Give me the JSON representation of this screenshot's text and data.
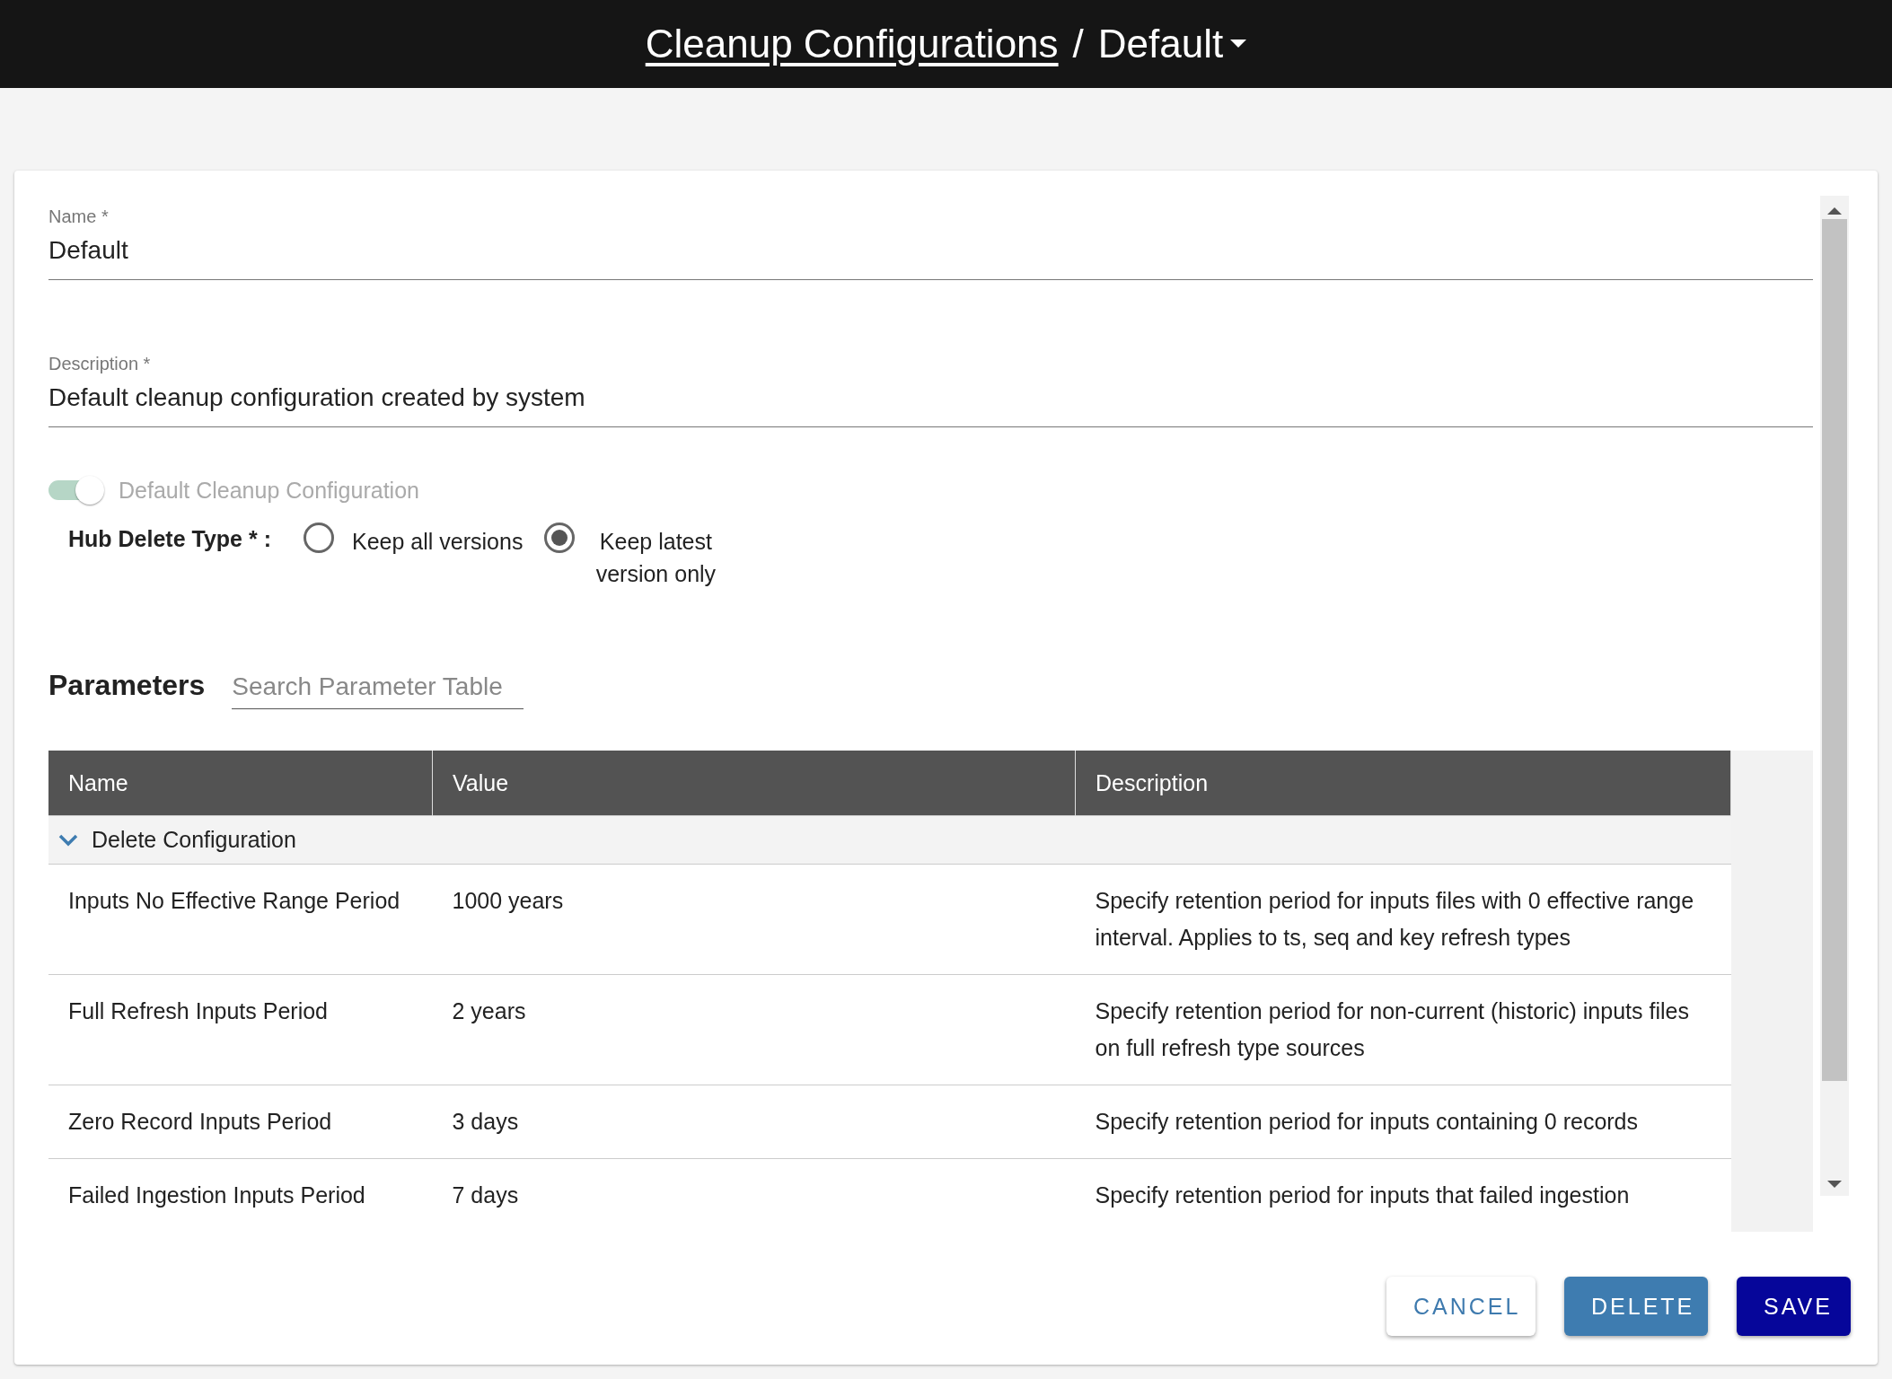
{
  "header": {
    "breadcrumb_link": "Cleanup Configurations",
    "separator": "/",
    "current": "Default"
  },
  "form": {
    "name": {
      "label": "Name *",
      "value": "Default"
    },
    "description": {
      "label": "Description *",
      "value": "Default cleanup configuration created by system"
    },
    "default_toggle": {
      "label": "Default Cleanup Configuration",
      "on": true,
      "disabled": true
    },
    "hub_delete_type": {
      "label": "Hub Delete Type * :",
      "options": [
        {
          "label": "Keep all versions",
          "selected": false
        },
        {
          "label": "Keep latest version only",
          "selected": true
        }
      ]
    }
  },
  "parameters": {
    "title": "Parameters",
    "search": {
      "placeholder": "Search Parameter Table"
    },
    "columns": [
      "Name",
      "Value",
      "Description"
    ],
    "groups": [
      {
        "label": "Delete Configuration",
        "expanded": true,
        "rows": [
          {
            "name": "Inputs No Effective Range Period",
            "value": "1000 years",
            "description": "Specify retention period for inputs files with 0 effective range interval. Applies to ts, seq and key refresh types"
          },
          {
            "name": "Full Refresh Inputs Period",
            "value": "2 years",
            "description": "Specify retention period for non-current (historic) inputs files on full refresh type sources"
          },
          {
            "name": "Zero Record Inputs Period",
            "value": "3 days",
            "description": "Specify retention period for inputs containing 0 records"
          },
          {
            "name": "Failed Ingestion Inputs Period",
            "value": "7 days",
            "description": "Specify retention period for inputs that failed ingestion"
          }
        ]
      }
    ]
  },
  "buttons": [
    {
      "label": "CANCEL",
      "kind": "outline"
    },
    {
      "label": "DELETE",
      "kind": "secondary"
    },
    {
      "label": "SAVE",
      "kind": "primary"
    }
  ]
}
